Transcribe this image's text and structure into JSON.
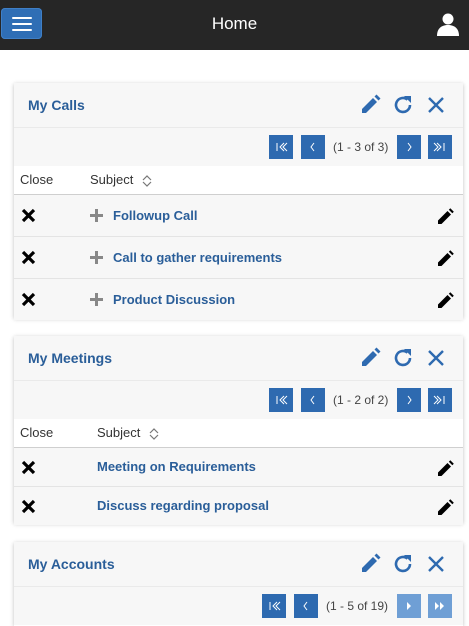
{
  "header": {
    "title": "Home",
    "menu_icon": "hamburger-menu-icon",
    "user_icon": "user-icon",
    "bg_color": "#262626",
    "accent": "#2f6eb5"
  },
  "dashlets": {
    "calls": {
      "title": "My Calls",
      "page_info": "(1 - 3 of 3)",
      "col_close": "Close",
      "col_subject": "Subject",
      "rows": [
        {
          "subject": "Followup Call"
        },
        {
          "subject": "Call to gather requirements"
        },
        {
          "subject": "Product Discussion"
        }
      ]
    },
    "meetings": {
      "title": "My Meetings",
      "page_info": "(1 - 2 of 2)",
      "col_close": "Close",
      "col_subject": "Subject",
      "rows": [
        {
          "subject": "Meeting on Requirements"
        },
        {
          "subject": "Discuss regarding proposal"
        }
      ]
    },
    "accounts": {
      "title": "My Accounts",
      "page_info": "(1 - 5 of 19)"
    }
  }
}
